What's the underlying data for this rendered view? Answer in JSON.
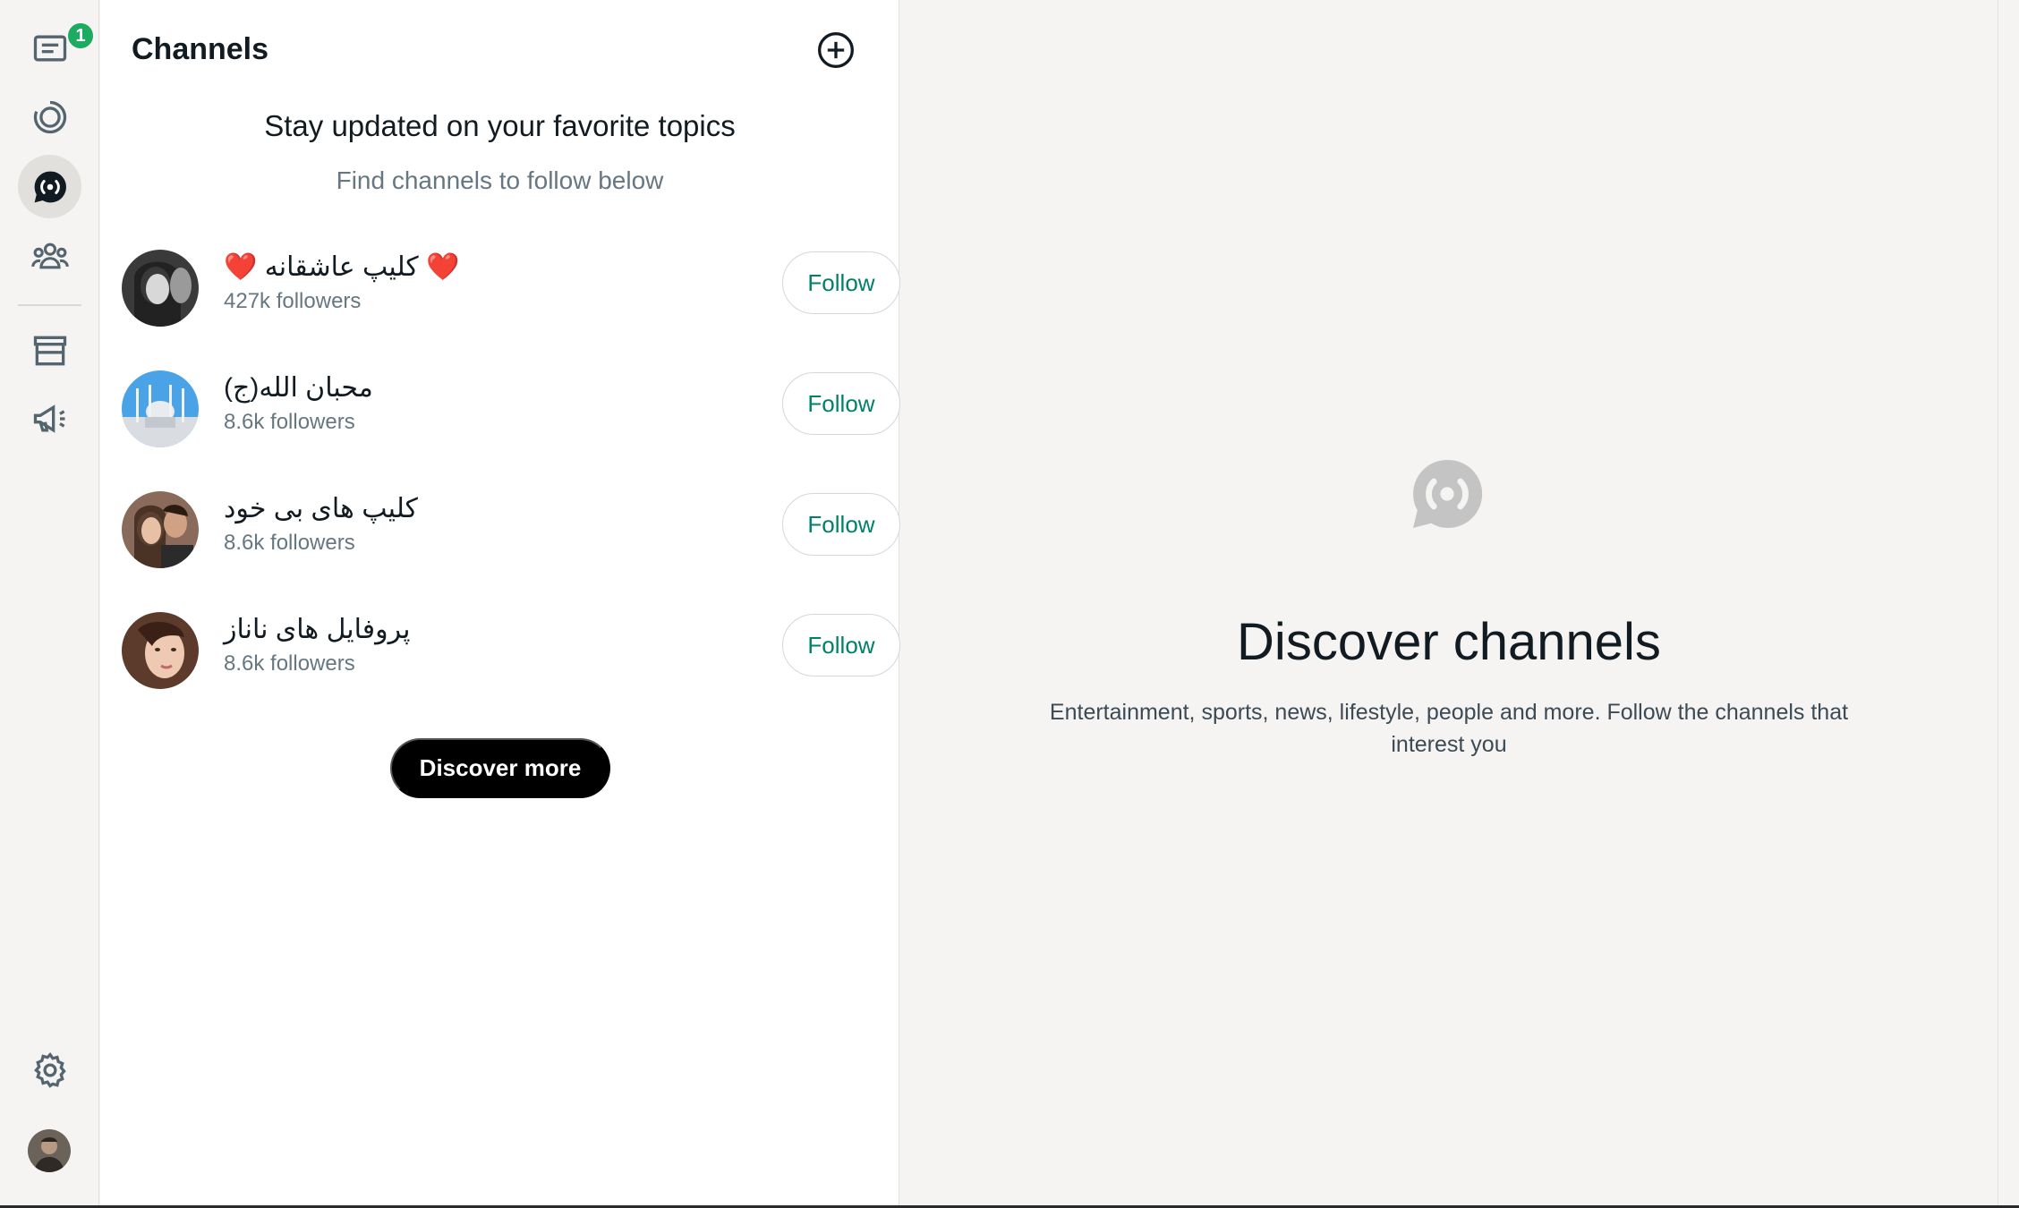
{
  "rail": {
    "chats_badge": "1",
    "items": [
      {
        "name": "chats",
        "icon": "chats-icon"
      },
      {
        "name": "status",
        "icon": "status-icon"
      },
      {
        "name": "channels",
        "icon": "channels-icon",
        "active": true
      },
      {
        "name": "communities",
        "icon": "communities-icon"
      },
      {
        "name": "tools",
        "icon": "store-icon"
      },
      {
        "name": "advertise",
        "icon": "megaphone-icon"
      }
    ],
    "settings_icon": "gear-icon",
    "profile_icon": "avatar"
  },
  "panel": {
    "title": "Channels",
    "add_icon": "plus-circle-icon",
    "intro_title": "Stay updated on your favorite topics",
    "intro_subtitle": "Find channels to follow below",
    "channels": [
      {
        "name": "❤️ کلیپ عاشقانه ❤️",
        "followers": "427k followers",
        "follow_label": "Follow"
      },
      {
        "name": "محبان الله(ج)",
        "followers": "8.6k followers",
        "follow_label": "Follow"
      },
      {
        "name": "کلیپ های بی خود",
        "followers": "8.6k followers",
        "follow_label": "Follow"
      },
      {
        "name": "پروفایل های ناناز",
        "followers": "8.6k followers",
        "follow_label": "Follow"
      }
    ],
    "discover_more_label": "Discover more"
  },
  "main": {
    "icon": "channels-icon",
    "title": "Discover channels",
    "description": "Entertainment, sports, news, lifestyle, people and more. Follow the channels that interest you"
  },
  "colors": {
    "accent_green": "#1daa61",
    "follow_text": "#008069",
    "background": "#f5f4f2"
  }
}
